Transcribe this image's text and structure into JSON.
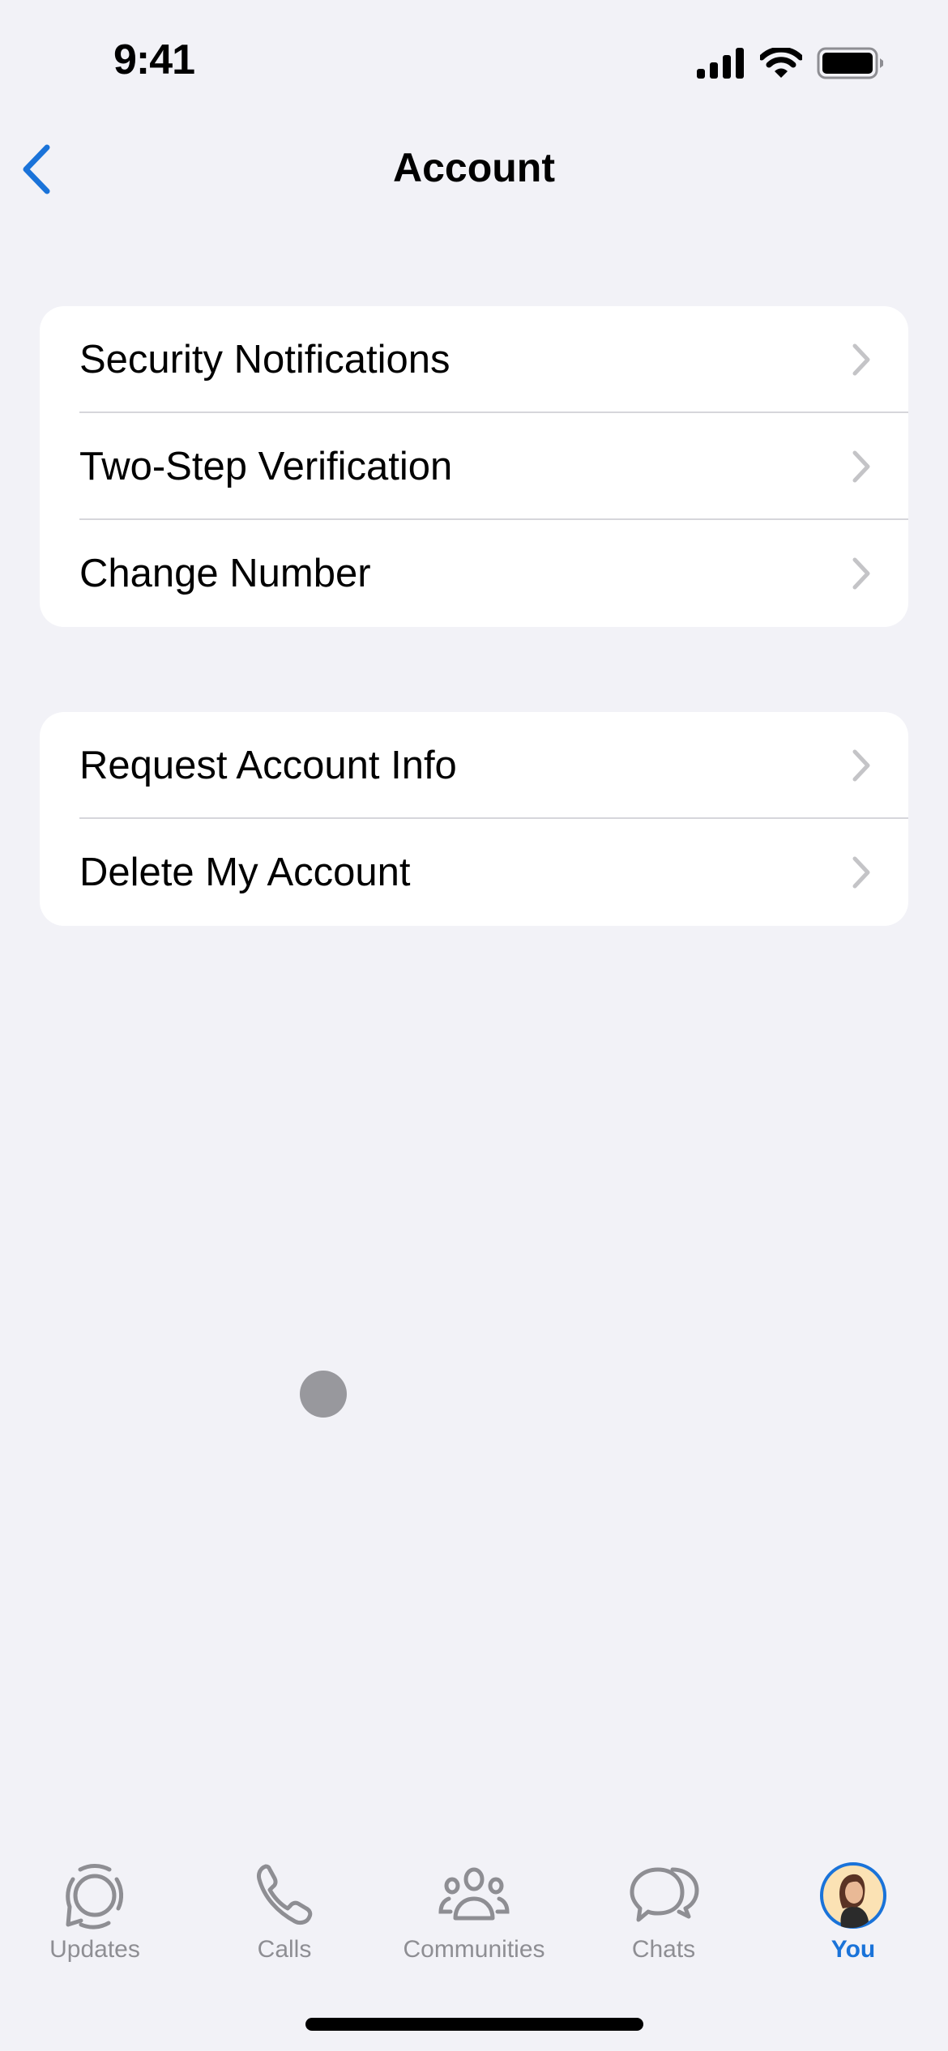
{
  "status_bar": {
    "time": "9:41",
    "icons": [
      "cellular-signal-icon",
      "wifi-icon",
      "battery-icon"
    ]
  },
  "nav": {
    "title": "Account",
    "back_icon": "chevron-left-icon"
  },
  "colors": {
    "accent": "#1a73d9",
    "background": "#f2f2f7",
    "card": "#ffffff",
    "inactive_tab": "#8e8e93",
    "chevron": "#c4c4c7",
    "divider": "#d6d6db"
  },
  "groups": [
    {
      "items": [
        {
          "label": "Security Notifications"
        },
        {
          "label": "Two-Step Verification"
        },
        {
          "label": "Change Number"
        }
      ]
    },
    {
      "items": [
        {
          "label": "Request Account Info"
        },
        {
          "label": "Delete My Account"
        }
      ]
    }
  ],
  "tab_bar": {
    "tabs": [
      {
        "label": "Updates",
        "icon": "updates-icon",
        "active": false
      },
      {
        "label": "Calls",
        "icon": "phone-icon",
        "active": false
      },
      {
        "label": "Communities",
        "icon": "communities-icon",
        "active": false
      },
      {
        "label": "Chats",
        "icon": "chats-icon",
        "active": false
      },
      {
        "label": "You",
        "icon": "avatar",
        "active": true
      }
    ]
  }
}
